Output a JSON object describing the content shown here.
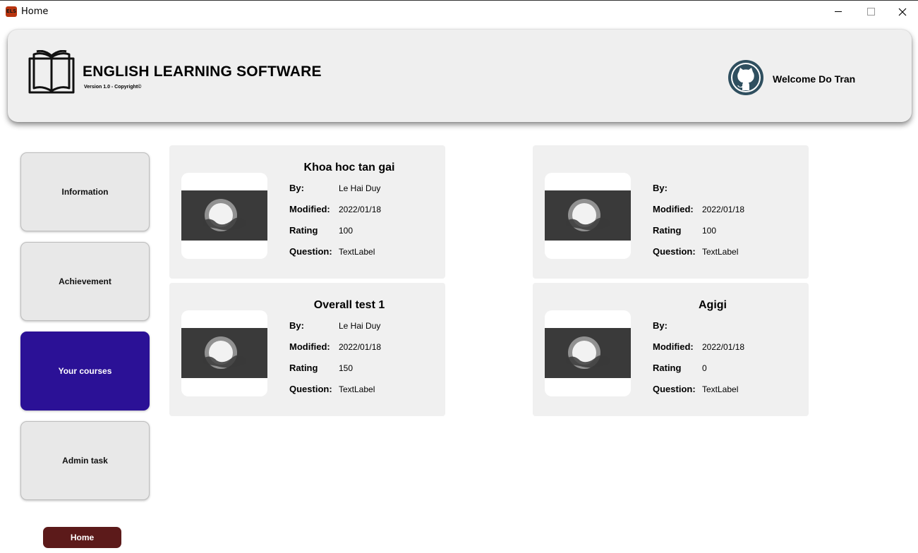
{
  "window": {
    "title": "Home",
    "icon_text": "ELS",
    "icon_color": "#b8340f"
  },
  "header": {
    "app_name": "ENGLISH LEARNING SOFTWARE",
    "version": "Version 1.0 - Copyright©",
    "welcome": "Welcome Do Tran",
    "logo_icon": "open-book-icon",
    "avatar_icon": "github-icon"
  },
  "sidebar": {
    "items": [
      {
        "label": "Information",
        "active": false
      },
      {
        "label": "Achievement",
        "active": false
      },
      {
        "label": "Your courses",
        "active": true
      },
      {
        "label": "Admin task",
        "active": false
      }
    ],
    "home_label": "Home",
    "active_color": "#2b1196",
    "home_color": "#5c1a1a"
  },
  "labels": {
    "by": "By:",
    "modified": "Modified:",
    "rating": "Rating",
    "question": "Question:"
  },
  "courses": [
    {
      "title": "Khoa hoc tan gai",
      "by": "Le Hai Duy",
      "modified": "2022/01/18",
      "rating": "100",
      "question": "TextLabel"
    },
    {
      "title": "",
      "by": "",
      "modified": "2022/01/18",
      "rating": "100",
      "question": "TextLabel"
    },
    {
      "title": "Overall test 1",
      "by": "Le Hai Duy",
      "modified": "2022/01/18",
      "rating": "150",
      "question": "TextLabel"
    },
    {
      "title": "Agigi",
      "by": "",
      "modified": "2022/01/18",
      "rating": "0",
      "question": "TextLabel"
    }
  ]
}
